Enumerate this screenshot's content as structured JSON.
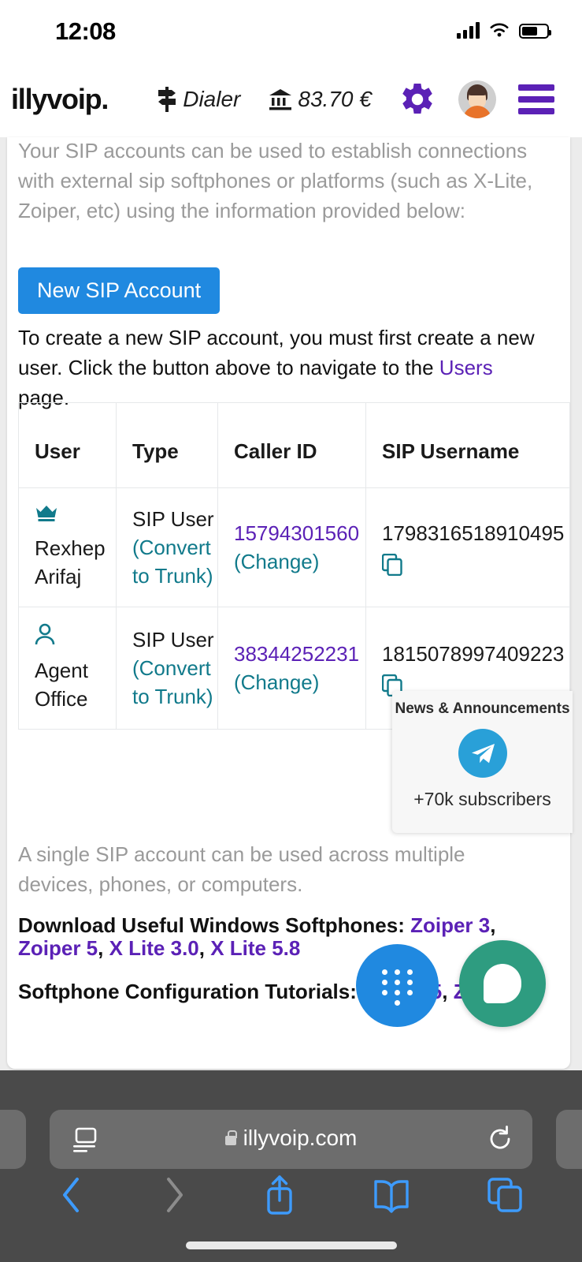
{
  "status_bar": {
    "time": "12:08",
    "icons": [
      "cellular-signal-icon",
      "wifi-icon",
      "battery-icon"
    ]
  },
  "app_header": {
    "logo": "illyvoip.",
    "dialer_label": "Dialer",
    "balance": "83.70 €",
    "icons": [
      "signpost-icon",
      "bank-icon",
      "gear-icon",
      "avatar",
      "hamburger-menu-icon"
    ]
  },
  "content": {
    "intro_line1": "Your SIP accounts can be used to establish connections",
    "intro_line2": "with external sip softphones or platforms (such as X-Lite,",
    "intro_line3": "Zoiper, etc) using the information provided below:",
    "new_sip_button": "New SIP Account",
    "instruction_pre": "To create a new SIP account, you must first create a new user. Click the button above to navigate to the ",
    "instruction_link": "Users",
    "instruction_post": " page.",
    "tail_text": "A single SIP account can be used across multiple devices, phones, or computers.",
    "downloads_label": "Download Useful Windows Softphones:",
    "downloads_links": [
      "Zoiper 3",
      "Zoiper 5",
      "X Lite 3.0",
      "X Lite 5.8"
    ],
    "tutorials_label": "Softphone Configuration Tutorials:",
    "tutorials_links": [
      "Zoiper 5",
      "Zoiper 3"
    ]
  },
  "table": {
    "headers": [
      "User",
      "Type",
      "Caller ID",
      "SIP Username"
    ],
    "rows": [
      {
        "icon": "crown-icon",
        "user": "Rexhep Arifaj",
        "type": "SIP User",
        "type_action": "(Convert to Trunk)",
        "caller_id": "15794301560",
        "caller_id_action": "(Change)",
        "sip_username": "1798316518910495",
        "copy_icon": "copy-icon"
      },
      {
        "icon": "person-icon",
        "user": "Agent Office",
        "type": "SIP User",
        "type_action": "(Convert to Trunk)",
        "caller_id": "38344252231",
        "caller_id_action": "(Change)",
        "sip_username": "1815078997409223",
        "copy_icon": "copy-icon"
      }
    ]
  },
  "popup": {
    "title": "News & Announcements",
    "icon": "telegram-icon",
    "subscribers": "+70k subscribers"
  },
  "fabs": {
    "dialer": "dialpad-icon",
    "chat": "chat-bubble-icon"
  },
  "browser": {
    "url": "illyvoip.com",
    "reader_icon": "reader-view-icon",
    "reload_icon": "reload-icon",
    "back_icon": "back-chevron-icon",
    "forward_icon": "forward-chevron-icon",
    "share_icon": "share-icon",
    "bookmarks_icon": "bookmarks-icon",
    "tabs_icon": "tabs-icon"
  },
  "colors": {
    "brand_purple": "#5b21b6",
    "button_blue": "#2089e0",
    "teal": "#117a8b",
    "fab_green": "#2e9c80",
    "telegram_blue": "#29a0d8"
  }
}
